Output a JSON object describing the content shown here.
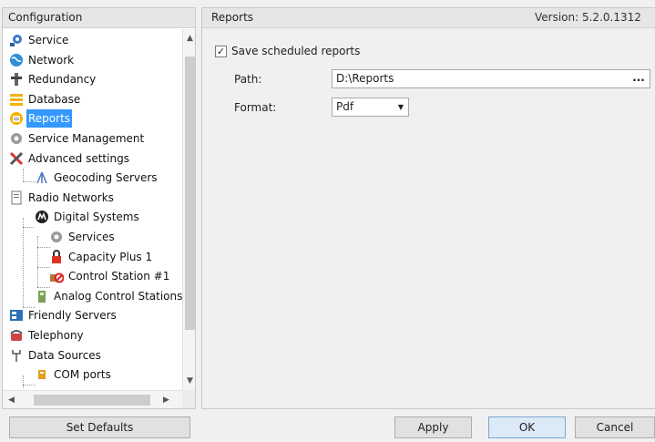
{
  "left_panel": {
    "title": "Configuration",
    "tree": [
      {
        "label": "Service",
        "icon": "service-icon",
        "level": 0
      },
      {
        "label": "Network",
        "icon": "globe-icon",
        "level": 0
      },
      {
        "label": "Redundancy",
        "icon": "redundancy-icon",
        "level": 0
      },
      {
        "label": "Database",
        "icon": "database-icon",
        "level": 0
      },
      {
        "label": "Reports",
        "icon": "reports-icon",
        "level": 0,
        "selected": true
      },
      {
        "label": "Service Management",
        "icon": "gear-icon",
        "level": 0
      },
      {
        "label": "Advanced settings",
        "icon": "tools-icon",
        "level": 0
      },
      {
        "label": "Geocoding Servers",
        "icon": "geocoding-icon",
        "level": 1
      },
      {
        "label": "Radio Networks",
        "icon": "radio-networks-icon",
        "level": 0
      },
      {
        "label": "Digital Systems",
        "icon": "motorola-icon",
        "level": 1
      },
      {
        "label": "Services",
        "icon": "gear-icon",
        "level": 2
      },
      {
        "label": "Capacity Plus 1",
        "icon": "capacity-lock-icon",
        "level": 2
      },
      {
        "label": "Control Station #1",
        "icon": "control-station-icon",
        "level": 2
      },
      {
        "label": "Analog Control Stations",
        "icon": "analog-radio-icon",
        "level": 1
      },
      {
        "label": "Friendly Servers",
        "icon": "friendly-servers-icon",
        "level": 0
      },
      {
        "label": "Telephony",
        "icon": "telephone-icon",
        "level": 0
      },
      {
        "label": "Data Sources",
        "icon": "data-sources-icon",
        "level": 0
      },
      {
        "label": "COM ports",
        "icon": "com-port-icon",
        "level": 1
      }
    ]
  },
  "right_panel": {
    "title": "Reports",
    "version": "Version: 5.2.0.1312",
    "save_scheduled_label": "Save scheduled reports",
    "save_scheduled_checked": true,
    "path_label": "Path:",
    "path_value": "D:\\Reports",
    "path_browse": "...",
    "format_label": "Format:",
    "format_value": "Pdf"
  },
  "buttons": {
    "set_defaults": "Set Defaults",
    "apply": "Apply",
    "ok": "OK",
    "cancel": "Cancel"
  },
  "colors": {
    "selection": "#3399ff",
    "window_bg": "#f0f0f0"
  }
}
